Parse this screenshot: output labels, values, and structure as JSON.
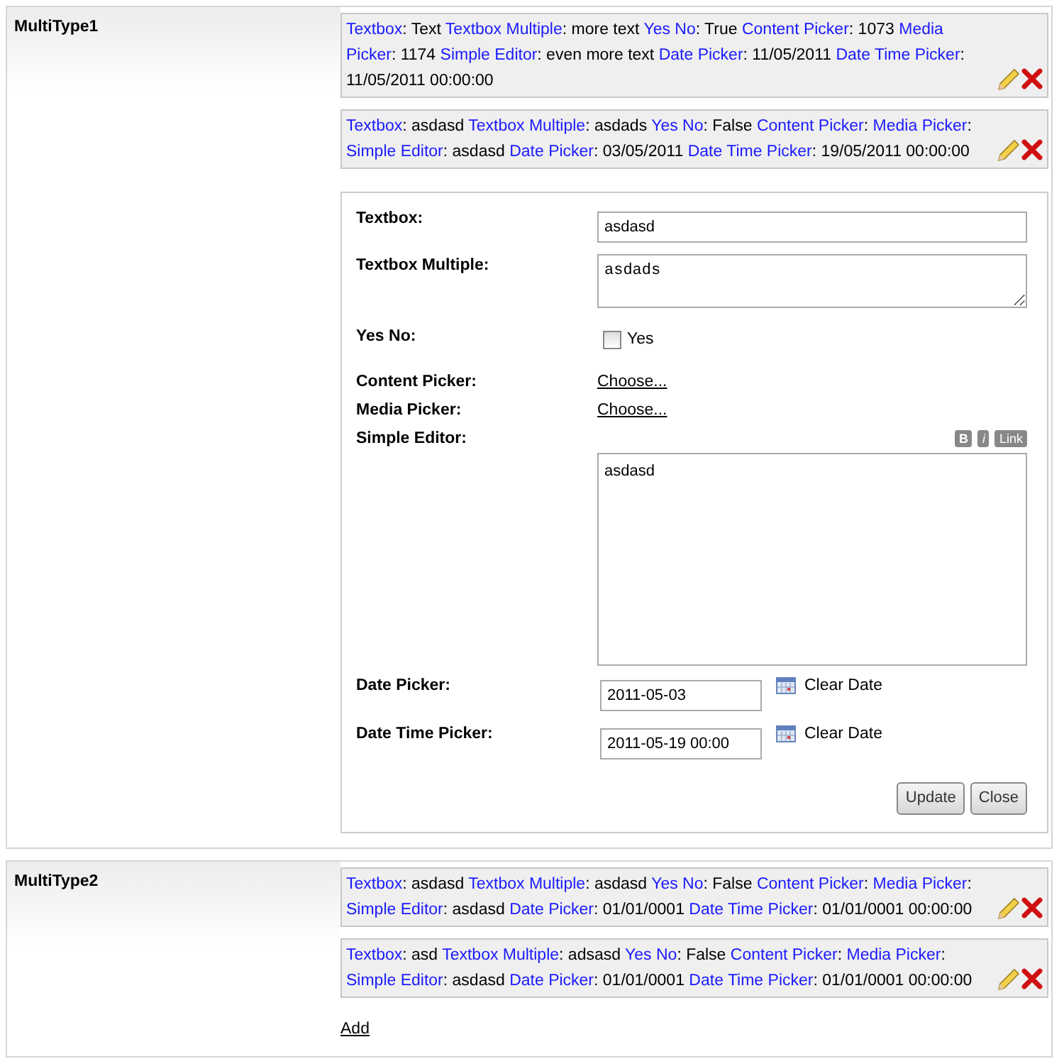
{
  "sections": [
    {
      "title": "MultiType1",
      "entries": [
        {
          "fields": [
            {
              "label": "Textbox",
              "value": ": Text"
            },
            {
              "label": "Textbox Multiple",
              "value": ": more text"
            },
            {
              "label": "Yes No",
              "value": ": True"
            },
            {
              "label": "Content Picker",
              "value": ": 1073"
            },
            {
              "label": "Media Picker",
              "value": ": 1174"
            },
            {
              "label": "Simple Editor",
              "value": ": even more text"
            },
            {
              "label": "Date Picker",
              "value": ": 11/05/2011"
            },
            {
              "label": "Date Time Picker",
              "value": ": 11/05/2011 00:00:00"
            }
          ]
        },
        {
          "fields": [
            {
              "label": "Textbox",
              "value": ": asdasd"
            },
            {
              "label": "Textbox Multiple",
              "value": ": asdads"
            },
            {
              "label": "Yes No",
              "value": ": False"
            },
            {
              "label": "Content Picker",
              "value": ":"
            },
            {
              "label": "Media Picker",
              "value": ":"
            },
            {
              "label": "Simple Editor",
              "value": ": asdasd"
            },
            {
              "label": "Date Picker",
              "value": ": 03/05/2011"
            },
            {
              "label": "Date Time Picker",
              "value": ": 19/05/2011 00:00:00"
            }
          ]
        }
      ],
      "editor": {
        "rows": [
          {
            "kind": "text",
            "label": "Textbox:",
            "value": "asdasd"
          },
          {
            "kind": "textarea",
            "label": "Textbox Multiple:",
            "value": "asdads"
          },
          {
            "kind": "checkbox",
            "label": "Yes No:",
            "option": "Yes",
            "checked": false
          },
          {
            "kind": "link",
            "label": "Content Picker:",
            "link": "Choose..."
          },
          {
            "kind": "link",
            "label": "Media Picker:",
            "link": "Choose..."
          },
          {
            "kind": "richtext",
            "label": "Simple Editor:",
            "toolbar": [
              "B",
              "i",
              "Link"
            ],
            "value": "asdasd"
          },
          {
            "kind": "date",
            "label": "Date Picker:",
            "value": "2011-05-03",
            "clear": "Clear Date"
          },
          {
            "kind": "date",
            "label": "Date Time Picker:",
            "value": "2011-05-19 00:00",
            "clear": "Clear Date"
          }
        ],
        "buttons": [
          "Update",
          "Close"
        ]
      }
    },
    {
      "title": "MultiType2",
      "entries": [
        {
          "fields": [
            {
              "label": "Textbox",
              "value": ": asdasd"
            },
            {
              "label": "Textbox Multiple",
              "value": ": asdasd"
            },
            {
              "label": "Yes No",
              "value": ": False"
            },
            {
              "label": "Content Picker",
              "value": ":"
            },
            {
              "label": "Media Picker",
              "value": ":"
            },
            {
              "label": "Simple Editor",
              "value": ": asdasd"
            },
            {
              "label": "Date Picker",
              "value": ": 01/01/0001"
            },
            {
              "label": "Date Time Picker",
              "value": ": 01/01/0001 00:00:00"
            }
          ]
        },
        {
          "fields": [
            {
              "label": "Textbox",
              "value": ": asd"
            },
            {
              "label": "Textbox Multiple",
              "value": ": adsasd"
            },
            {
              "label": "Yes No",
              "value": ": False"
            },
            {
              "label": "Content Picker",
              "value": ":"
            },
            {
              "label": "Media Picker",
              "value": ":"
            },
            {
              "label": "Simple Editor",
              "value": ": asdasd"
            },
            {
              "label": "Date Picker",
              "value": ": 01/01/0001"
            },
            {
              "label": "Date Time Picker",
              "value": ": 01/01/0001 00:00:00"
            }
          ]
        }
      ],
      "add_link": "Add"
    }
  ]
}
